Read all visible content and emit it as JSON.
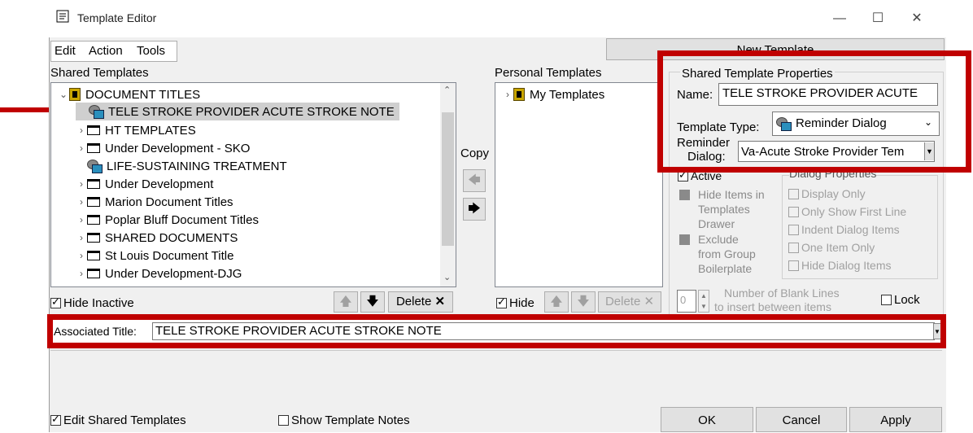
{
  "window": {
    "title": "Template Editor",
    "minimize": "—",
    "maximize": "☐",
    "close": "✕"
  },
  "menu": {
    "edit": "Edit",
    "action": "Action",
    "tools": "Tools"
  },
  "new_template_button": "New Template",
  "shared": {
    "label": "Shared Templates",
    "tree": [
      {
        "label": "DOCUMENT TITLES",
        "icon": "book-icon",
        "chevron": "⌄"
      },
      {
        "label": "TELE STROKE PROVIDER ACUTE STROKE NOTE",
        "icon": "reminder-dialog-icon",
        "chevron": ""
      },
      {
        "label": "HT TEMPLATES",
        "icon": "folder-icon",
        "chevron": "›"
      },
      {
        "label": "Under Development - SKO",
        "icon": "folder-icon",
        "chevron": "›"
      },
      {
        "label": "LIFE-SUSTAINING TREATMENT",
        "icon": "reminder-dialog-icon",
        "chevron": ""
      },
      {
        "label": "Under Development",
        "icon": "folder-icon",
        "chevron": "›"
      },
      {
        "label": "Marion Document Titles",
        "icon": "folder-icon",
        "chevron": "›"
      },
      {
        "label": "Poplar Bluff Document Titles",
        "icon": "folder-icon",
        "chevron": "›"
      },
      {
        "label": "SHARED DOCUMENTS",
        "icon": "folder-icon",
        "chevron": "›"
      },
      {
        "label": "St Louis Document Title",
        "icon": "folder-icon",
        "chevron": "›"
      },
      {
        "label": "Under Development-DJG",
        "icon": "folder-icon",
        "chevron": "›"
      }
    ],
    "hide_inactive": "Hide Inactive",
    "delete": "Delete"
  },
  "copy_label": "Copy",
  "personal": {
    "label": "Personal Templates",
    "tree": [
      {
        "label": "My Templates",
        "icon": "book-icon",
        "chevron": "›"
      }
    ],
    "hide": "Hide",
    "delete": "Delete"
  },
  "properties": {
    "group": "Shared Template Properties",
    "name_label": "Name:",
    "name_value": "TELE STROKE PROVIDER ACUTE",
    "type_label": "Template Type:",
    "type_value": "Reminder Dialog",
    "reminder_label_1": "Reminder",
    "reminder_label_2": "Dialog:",
    "reminder_value": "Va-Acute Stroke Provider Tem",
    "active": "Active",
    "hide_items": [
      "Hide Items in",
      "Templates",
      "Drawer"
    ],
    "exclude": [
      "Exclude",
      "from Group",
      "Boilerplate"
    ],
    "dialog_props": "Dialog Properties",
    "display_only": "Display Only",
    "only_first_line": "Only Show First Line",
    "indent_items": "Indent Dialog Items",
    "one_item": "One Item Only",
    "hide_dialog_items": "Hide Dialog Items",
    "blank_lines_value": "0",
    "blank_lines_label_1": "Number of Blank Lines",
    "blank_lines_label_2": "to insert between items",
    "lock": "Lock"
  },
  "associated": {
    "label": "Associated Title:",
    "value": "TELE STROKE PROVIDER ACUTE STROKE NOTE"
  },
  "footer": {
    "edit_shared": "Edit Shared Templates",
    "show_notes": "Show Template Notes",
    "ok": "OK",
    "cancel": "Cancel",
    "apply": "Apply"
  },
  "colors": {
    "highlight": "#c00000",
    "selection": "#cfcfcf"
  }
}
